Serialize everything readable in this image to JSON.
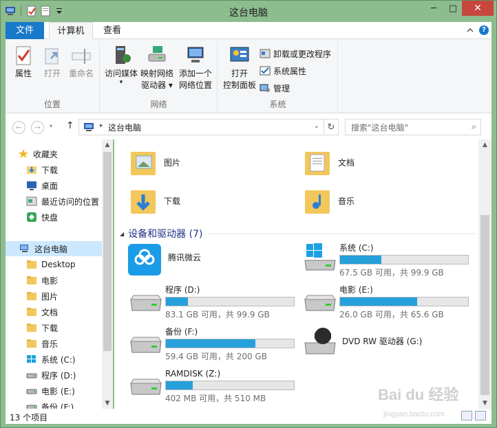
{
  "window": {
    "title": "这台电脑"
  },
  "window_controls": {
    "minimize": "─",
    "maximize": "□",
    "close": "✕"
  },
  "tabs": [
    {
      "label": "文件"
    },
    {
      "label": "计算机"
    },
    {
      "label": "查看"
    }
  ],
  "help_label": "?",
  "ribbon": {
    "location_group": {
      "label": "位置",
      "buttons": [
        {
          "label": "属性",
          "icon": "check-document-icon"
        },
        {
          "label": "打开",
          "icon": "open-arrow-icon"
        },
        {
          "label": "重命名",
          "icon": "rename-icon"
        }
      ]
    },
    "network_group": {
      "label": "网络",
      "buttons": [
        {
          "label_line1": "访问媒体",
          "label_line2": "▾",
          "icon": "media-server-icon"
        },
        {
          "label_line1": "映射网络",
          "label_line2": "驱动器 ▾",
          "icon": "network-drive-icon"
        },
        {
          "label_line1": "添加一个",
          "label_line2": "网络位置",
          "icon": "network-location-icon"
        }
      ]
    },
    "system_group": {
      "label": "系统",
      "big_button": {
        "label_line1": "打开",
        "label_line2": "控制面板",
        "icon": "control-panel-icon"
      },
      "small_buttons": [
        {
          "label": "卸载或更改程序",
          "icon": "programs-icon"
        },
        {
          "label": "系统属性",
          "icon": "system-properties-icon"
        },
        {
          "label": "管理",
          "icon": "manage-icon"
        }
      ]
    }
  },
  "address": {
    "back": "←",
    "forward": "→",
    "up": "↑",
    "separator": "▸",
    "crumb": "这台电脑",
    "dropdown": "⌄",
    "refresh": "↻",
    "search_placeholder": "搜索\"这台电脑\"",
    "search_icon": "⌕"
  },
  "nav": {
    "favorites": [
      {
        "label": "收藏夹",
        "icon": "star-icon"
      },
      {
        "label": "下载",
        "icon": "downloads-folder-icon"
      },
      {
        "label": "桌面",
        "icon": "desktop-icon"
      },
      {
        "label": "最近访问的位置",
        "icon": "recent-places-icon"
      },
      {
        "label": "快盘",
        "icon": "kuaipan-icon"
      }
    ],
    "this_pc": {
      "label": "这台电脑",
      "icon": "computer-icon"
    },
    "pc_items": [
      {
        "label": "Desktop",
        "icon": "folder-icon"
      },
      {
        "label": "电影",
        "icon": "folder-icon"
      },
      {
        "label": "图片",
        "icon": "folder-icon"
      },
      {
        "label": "文档",
        "icon": "folder-icon"
      },
      {
        "label": "下载",
        "icon": "folder-icon"
      },
      {
        "label": "音乐",
        "icon": "folder-icon"
      },
      {
        "label": "系统 (C:)",
        "icon": "windows-drive-icon"
      },
      {
        "label": "程序 (D:)",
        "icon": "drive-icon"
      },
      {
        "label": "电影 (E:)",
        "icon": "drive-icon"
      },
      {
        "label": "备份 (F:)",
        "icon": "drive-icon"
      }
    ]
  },
  "scroll_arrows": {
    "up": "▲",
    "down": "▼"
  },
  "folders": [
    {
      "name": "图片",
      "icon": "pictures-folder-icon"
    },
    {
      "name": "文档",
      "icon": "documents-folder-icon"
    },
    {
      "name": "下载",
      "icon": "downloads-folder-icon"
    },
    {
      "name": "音乐",
      "icon": "music-folder-icon"
    }
  ],
  "devices_section": {
    "arrow": "◢",
    "title": "设备和驱动器 (7)"
  },
  "drives": [
    {
      "name": "腾讯微云",
      "icon": "weiyun-icon",
      "free": "",
      "used_fraction": null
    },
    {
      "name": "系统 (C:)",
      "icon": "windows-drive-icon",
      "free": "67.5 GB 可用，共 99.9 GB",
      "used_fraction": 0.32
    },
    {
      "name": "程序 (D:)",
      "icon": "drive-icon",
      "free": "83.1 GB 可用，共 99.9 GB",
      "used_fraction": 0.17
    },
    {
      "name": "电影 (E:)",
      "icon": "drive-icon",
      "free": "26.0 GB 可用，共 65.6 GB",
      "used_fraction": 0.6
    },
    {
      "name": "备份 (F:)",
      "icon": "drive-icon",
      "free": "59.4 GB 可用，共 200 GB",
      "used_fraction": 0.7
    },
    {
      "name": "DVD RW 驱动器 (G:)",
      "icon": "dvd-drive-icon",
      "free": "",
      "used_fraction": null
    },
    {
      "name": "RAMDISK (Z:)",
      "icon": "drive-icon",
      "free": "402 MB 可用，共 510 MB",
      "used_fraction": 0.21
    }
  ],
  "status": {
    "item_count": "13 个项目"
  },
  "watermark": {
    "line1": "Bai du 经验",
    "line2": "jingyan.baidu.com"
  },
  "colors": {
    "accent": "#1979ca",
    "bar_fill": "#26a0da",
    "title_bg": "#8dbc8e",
    "close": "#c7463d"
  }
}
